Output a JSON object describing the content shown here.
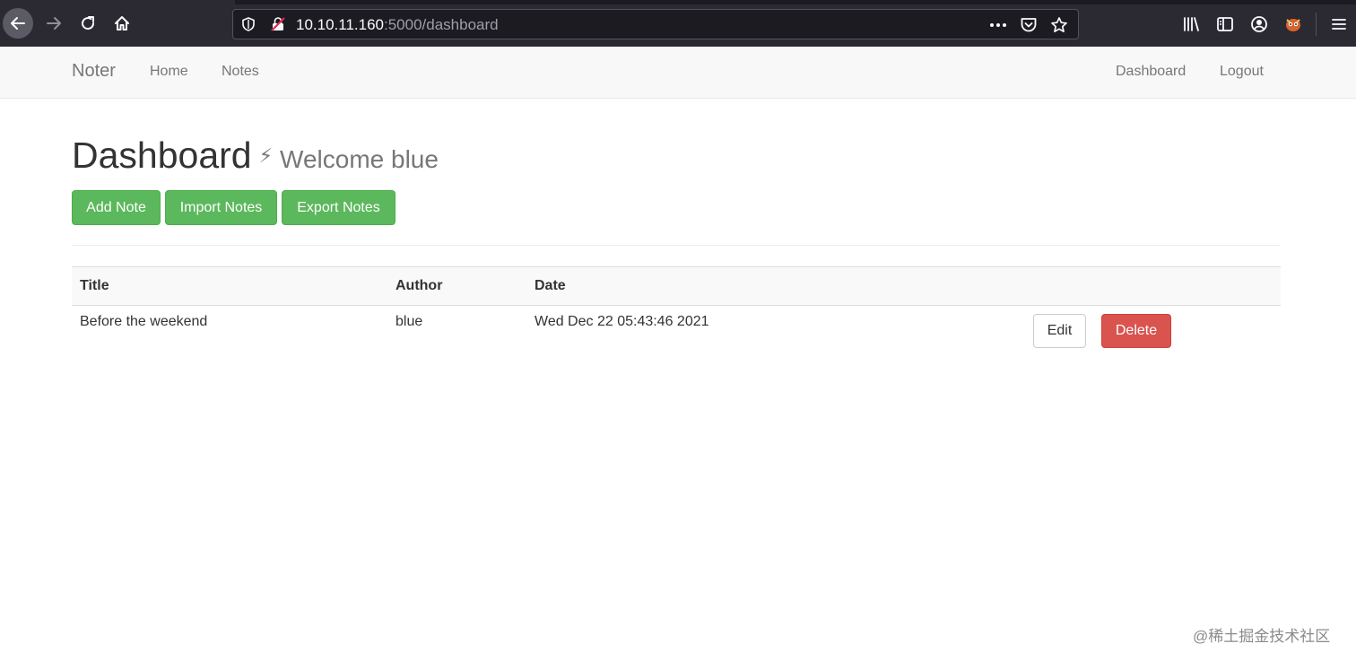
{
  "browser": {
    "url_host": "10.10.11.160",
    "url_rest": ":5000/dashboard",
    "icons": [
      "back-icon",
      "forward-icon",
      "reload-icon",
      "home-icon",
      "shield-icon",
      "insecure-lock-icon",
      "more-icon",
      "pocket-icon",
      "star-icon",
      "library-icon",
      "sidebar-icon",
      "account-icon",
      "extension-icon",
      "menu-icon"
    ]
  },
  "navbar": {
    "brand": "Noter",
    "home": "Home",
    "notes": "Notes",
    "dashboard": "Dashboard",
    "logout": "Logout"
  },
  "page": {
    "title": "Dashboard",
    "welcome": "Welcome blue"
  },
  "actions": {
    "add": "Add Note",
    "import": "Import Notes",
    "export": "Export Notes"
  },
  "table": {
    "headers": [
      "Title",
      "Author",
      "Date"
    ],
    "rows": [
      {
        "title": "Before the weekend",
        "author": "blue",
        "date": "Wed Dec 22 05:43:46 2021",
        "edit": "Edit",
        "delete": "Delete"
      }
    ]
  },
  "watermark": "@稀土掘金技术社区",
  "colors": {
    "success": "#5cb85c",
    "danger": "#d9534f",
    "chrome": "#2b2a33"
  }
}
